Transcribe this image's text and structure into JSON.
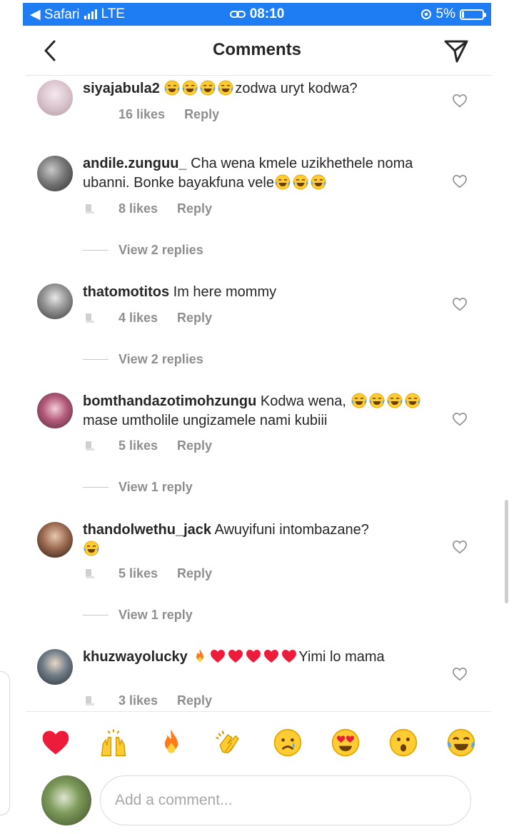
{
  "status_bar": {
    "back_app": "◀ Safari",
    "network": "LTE",
    "time": "08:10",
    "battery": "5%"
  },
  "header": {
    "title": "Comments"
  },
  "comments": [
    {
      "username": "siyajabula2",
      "text": "zodwa uryt kodwa?",
      "likes": "16 likes",
      "reply": "Reply"
    },
    {
      "username": "andile.zunguu_",
      "text": " Cha wena kmele uzikhethele noma ubanni. Bonke bayakfuna vele",
      "likes": "8 likes",
      "reply": "Reply",
      "view_replies": "View 2 replies"
    },
    {
      "username": "thatomotitos",
      "text": " Im here mommy",
      "likes": "4 likes",
      "reply": "Reply",
      "view_replies": "View 2 replies"
    },
    {
      "username": "bomthandazotimohzungu",
      "text_a": " Kodwa wena,",
      "text_b": "mase umtholile ungizamele nami kubiii",
      "likes": "5 likes",
      "reply": "Reply",
      "view_replies": "View 1 reply"
    },
    {
      "username": "thandolwethu_jack",
      "text": " Awuyifuni intombazane?",
      "likes": "5 likes",
      "reply": "Reply",
      "view_replies": "View 1 reply"
    },
    {
      "username": "khuzwayolucky",
      "text": "Yimi lo mama",
      "likes": "3 likes",
      "reply": "Reply"
    }
  ],
  "reactions": [
    "heart",
    "raised-hands",
    "fire",
    "clapping-hands",
    "crying-face",
    "heart-eyes",
    "surprised-face",
    "tears-of-joy"
  ],
  "composer": {
    "placeholder": "Add a comment..."
  },
  "colors": {
    "status_blue": "#1e7df2",
    "heart_red": "#ed1c3a",
    "muted_gray": "#8e8e8e"
  }
}
